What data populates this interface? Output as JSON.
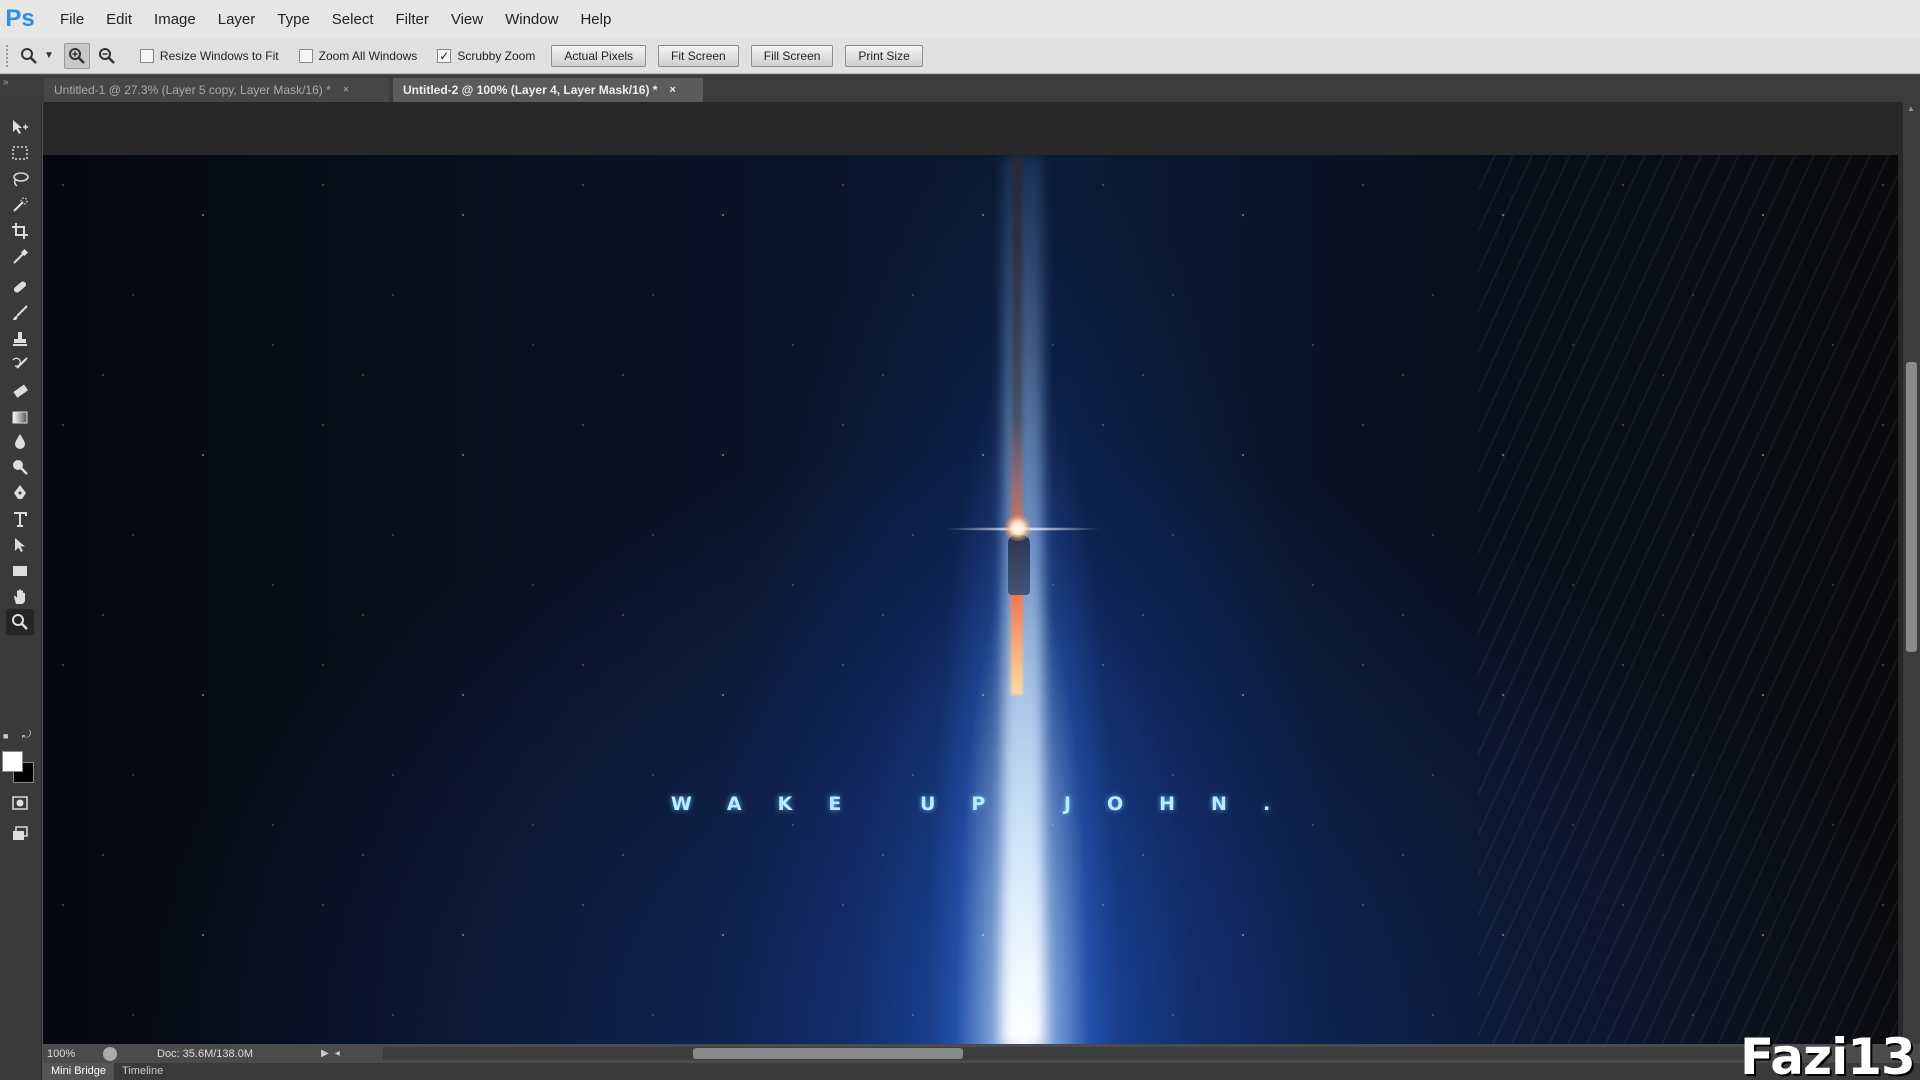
{
  "app": {
    "logo": "Ps",
    "menu": [
      "File",
      "Edit",
      "Image",
      "Layer",
      "Type",
      "Select",
      "Filter",
      "View",
      "Window",
      "Help"
    ]
  },
  "options": {
    "resize_windows_to_fit": {
      "label": "Resize Windows to Fit",
      "checked": false
    },
    "zoom_all_windows": {
      "label": "Zoom All Windows",
      "checked": false
    },
    "scrubby_zoom": {
      "label": "Scrubby Zoom",
      "checked": true
    },
    "buttons": [
      "Actual Pixels",
      "Fit Screen",
      "Fill Screen",
      "Print Size"
    ]
  },
  "tabs": [
    {
      "label": "Untitled-1 @ 27.3% (Layer 5 copy, Layer Mask/16) *",
      "close": "×",
      "active": false
    },
    {
      "label": "Untitled-2 @ 100% (Layer 4, Layer Mask/16) *",
      "close": "×",
      "active": true
    }
  ],
  "tools": [
    "move-tool-icon",
    "marquee-tool-icon",
    "lasso-tool-icon",
    "quick-selection-tool-icon",
    "crop-tool-icon",
    "eyedropper-tool-icon",
    "healing-brush-tool-icon",
    "brush-tool-icon",
    "clone-stamp-tool-icon",
    "history-brush-tool-icon",
    "eraser-tool-icon",
    "gradient-tool-icon",
    "blur-tool-icon",
    "dodge-tool-icon",
    "pen-tool-icon",
    "type-tool-icon",
    "path-selection-tool-icon",
    "rectangle-tool-icon",
    "hand-tool-icon",
    "zoom-tool-icon"
  ],
  "canvas": {
    "text": "WAKE UP JOHN."
  },
  "status": {
    "zoom": "100%",
    "doc": "Doc: 35.6M/138.0M"
  },
  "bottom_tabs": [
    "Mini Bridge",
    "Timeline"
  ],
  "watermark": "Fazi13",
  "colors": {
    "ps_blue": "#2f8ee6",
    "panel_dark": "#3a3a3a",
    "canvas_text": "#bfe9ff"
  }
}
